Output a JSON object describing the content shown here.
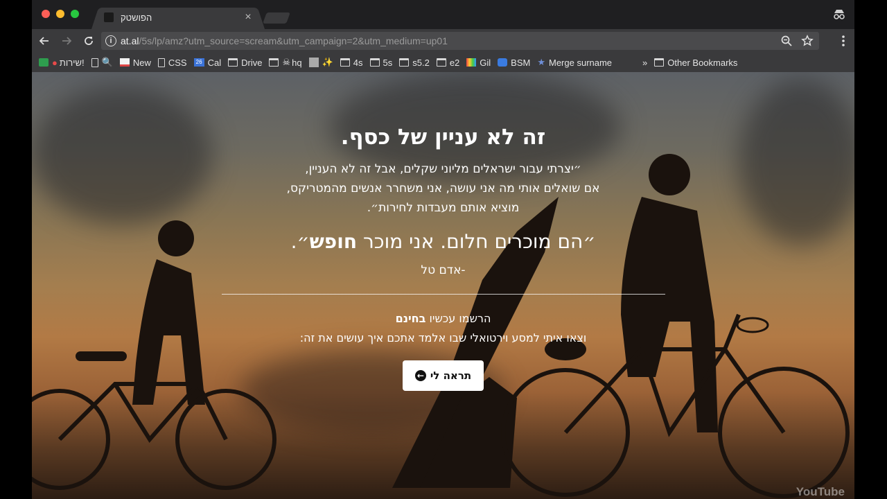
{
  "tab": {
    "title": "הפושטק",
    "close": "×"
  },
  "toolbar": {
    "url_host": "at.al",
    "url_rest": "/5s/lp/amz?utm_source=scream&utm_campaign=2&utm_medium=up01",
    "info_glyph": "i"
  },
  "bookmarks": {
    "items": [
      {
        "label": "שירות!",
        "icon": "sheets-icon"
      },
      {
        "label": "",
        "icon": "page-icon"
      },
      {
        "label": "New",
        "icon": "gmail-icon"
      },
      {
        "label": "CSS",
        "icon": "page-icon"
      },
      {
        "label": "Cal",
        "icon": "calendar-icon",
        "badge": "26"
      },
      {
        "label": "Drive",
        "icon": "folder-icon"
      },
      {
        "label": "hq",
        "icon": "folder-icon"
      },
      {
        "label": "",
        "icon": "avatar-icon"
      },
      {
        "label": "4s",
        "icon": "folder-icon"
      },
      {
        "label": "5s",
        "icon": "folder-icon"
      },
      {
        "label": "s5.2",
        "icon": "folder-icon"
      },
      {
        "label": "e2",
        "icon": "folder-icon"
      },
      {
        "label": "Gil",
        "icon": "color-icon"
      },
      {
        "label": "BSM",
        "icon": "bsm-icon"
      },
      {
        "label": "Merge surname",
        "icon": "star-icon"
      }
    ],
    "overflow": "»",
    "other": "Other Bookmarks"
  },
  "hero": {
    "headline": "זה לא עניין של כסף.",
    "quote_line1": "״יצרתי עבור ישראלים מליוני שקלים, אבל זה לא העניין,",
    "quote_line2": "אם שואלים אותי מה אני עושה, אני משחרר אנשים מהמטריקס,",
    "quote_line3": "מוציא אותם מעבדות לחירות״.",
    "tagline_before": "״הם מוכרים חלום. אני מוכר ",
    "tagline_bold": "חופש",
    "tagline_after": "״.",
    "author": "-אדם טל",
    "signup_before": "הרשמו עכשיו ",
    "signup_bold": "בחינם",
    "signup_line2": "וצאו איתי למסע וירטואלי שבו אלמד אתכם איך עושים את זה:",
    "cta_label": "תראה לי",
    "watermark": "YouTube"
  },
  "colors": {
    "frame": "#3a3a3c",
    "titlebar": "#1f1f21",
    "cta_bg": "#ffffff"
  }
}
